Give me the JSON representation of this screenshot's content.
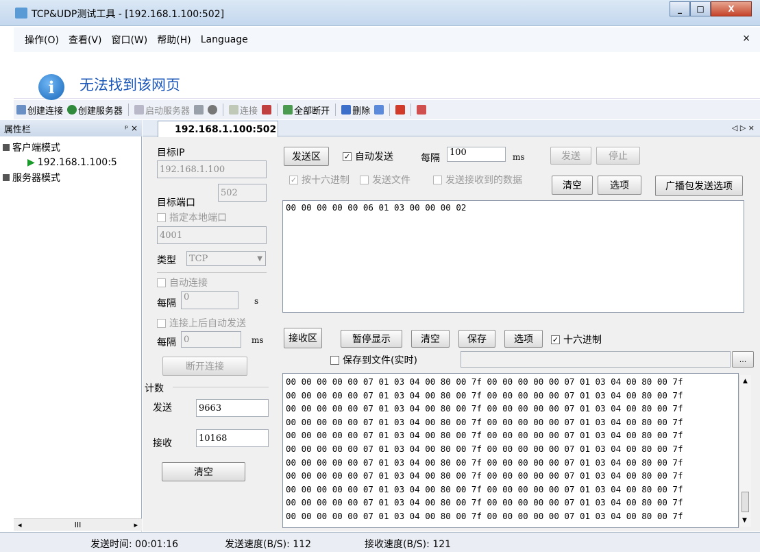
{
  "window": {
    "title": "TCP&UDP测试工具 - [192.168.1.100:502]",
    "min": "_",
    "max": "□",
    "close": "X"
  },
  "menu": {
    "items": [
      "操作(O)",
      "查看(V)",
      "窗口(W)",
      "帮助(H)",
      "Language"
    ],
    "close": "×"
  },
  "banner": {
    "text": "无法找到该网页"
  },
  "toolbar": {
    "create_conn": "创建连接",
    "create_server": "创建服务器",
    "start_server": "启动服务器",
    "connect": "连接",
    "disconnect_all": "全部断开",
    "delete": "删除"
  },
  "sidebar": {
    "title": "属性栏",
    "pin": "ᵖ ×",
    "client_mode": "客户端模式",
    "client_item": "192.168.1.100:5",
    "server_mode": "服务器模式",
    "scroll_mid": "III"
  },
  "tab": {
    "label": "192.168.1.100:502",
    "nav": "◁ ▷ ×"
  },
  "left": {
    "target_ip_label": "目标IP",
    "target_ip": "192.168.1.100",
    "target_port_label": "目标端口",
    "target_port": "502",
    "local_port_label": "指定本地端口",
    "local_port": "4001",
    "type_label": "类型",
    "type_value": "TCP",
    "auto_connect_label": "自动连接",
    "interval_label": "每隔",
    "interval1": "0",
    "unit_s": "s",
    "auto_send_label": "连接上后自动发送",
    "interval2": "0",
    "unit_ms": "ms",
    "disconnect_btn": "断开连接",
    "count_label": "计数",
    "send_label": "发送",
    "send_count": "9663",
    "recv_label": "接收",
    "recv_count": "10168",
    "clear_btn": "清空"
  },
  "send": {
    "area_btn": "发送区",
    "auto_send": "自动发送",
    "every": "每隔",
    "interval": "100",
    "unit": "ms",
    "send_btn": "发送",
    "stop_btn": "停止",
    "hex": "按十六进制",
    "send_file": "发送文件",
    "send_received": "发送接收到的数据",
    "clear": "清空",
    "options": "选项",
    "broadcast": "广播包发送选项",
    "content": "00 00 00 00 00 06 01 03 00 00 00 02"
  },
  "recv": {
    "area_btn": "接收区",
    "pause": "暂停显示",
    "clear": "清空",
    "save": "保存",
    "options": "选项",
    "hex": "十六进制",
    "save_file": "保存到文件(实时)",
    "browse": "...",
    "lines": [
      "00 00 00 00 00 07 01 03 04 00 80 00 7f 00 00 00 00 00 07 01 03 04 00 80 00 7f",
      "00 00 00 00 00 07 01 03 04 00 80 00 7f 00 00 00 00 00 07 01 03 04 00 80 00 7f",
      "00 00 00 00 00 07 01 03 04 00 80 00 7f 00 00 00 00 00 07 01 03 04 00 80 00 7f",
      "00 00 00 00 00 07 01 03 04 00 80 00 7f 00 00 00 00 00 07 01 03 04 00 80 00 7f",
      "00 00 00 00 00 07 01 03 04 00 80 00 7f 00 00 00 00 00 07 01 03 04 00 80 00 7f",
      "00 00 00 00 00 07 01 03 04 00 80 00 7f 00 00 00 00 00 07 01 03 04 00 80 00 7f",
      "00 00 00 00 00 07 01 03 04 00 80 00 7f 00 00 00 00 00 07 01 03 04 00 80 00 7f",
      "00 00 00 00 00 07 01 03 04 00 80 00 7f 00 00 00 00 00 07 01 03 04 00 80 00 7f",
      "00 00 00 00 00 07 01 03 04 00 80 00 7f 00 00 00 00 00 07 01 03 04 00 80 00 7f",
      "00 00 00 00 00 07 01 03 04 00 80 00 7f 00 00 00 00 00 07 01 03 04 00 80 00 7f",
      "00 00 00 00 00 07 01 03 04 00 80 00 7f 00 00 00 00 00 07 01 03 04 00 80 00 7f"
    ]
  },
  "status": {
    "send_time": "发送时间: 00:01:16",
    "send_speed": "发送速度(B/S): 112",
    "recv_speed": "接收速度(B/S): 121"
  }
}
